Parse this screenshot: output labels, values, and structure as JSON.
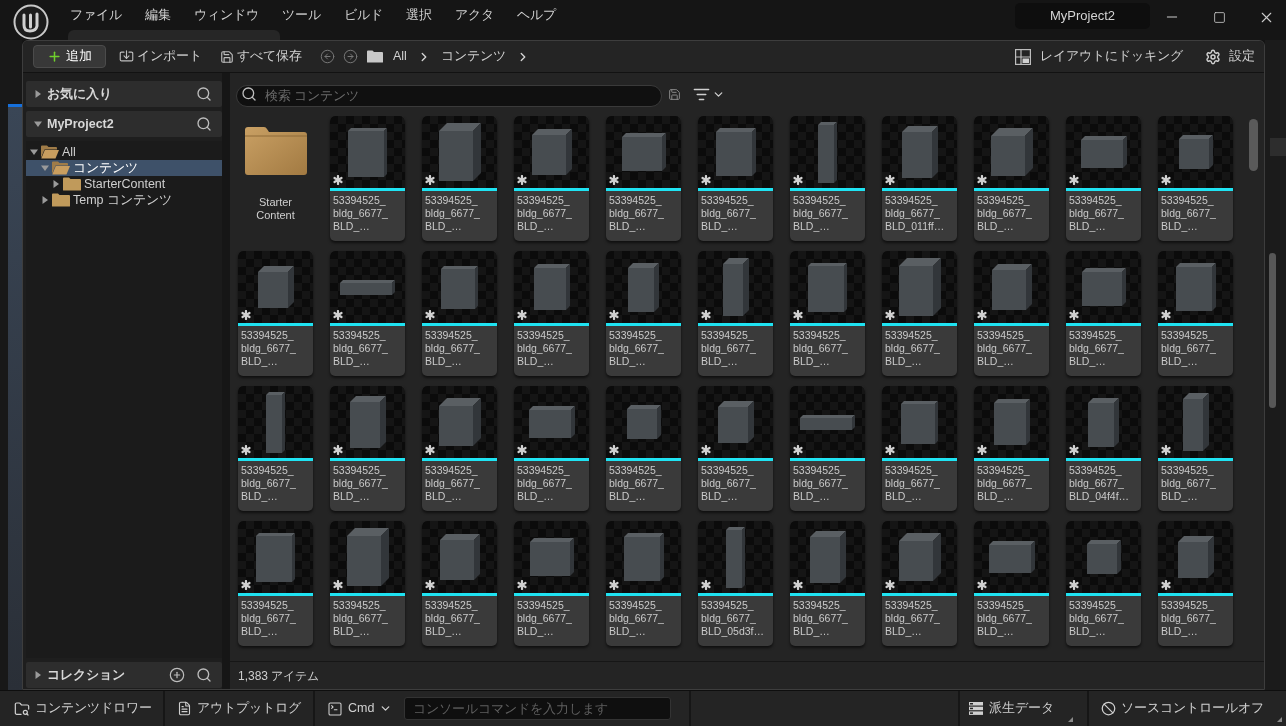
{
  "title_bar": {
    "menu": [
      "ファイル",
      "編集",
      "ウィンドウ",
      "ツール",
      "ビルド",
      "選択",
      "アクタ",
      "ヘルプ"
    ],
    "project_tab": "MyProject2"
  },
  "toolbar": {
    "add_button": "追加",
    "import_button": "インポート",
    "save_all_button": "すべて保存",
    "breadcrumb": [
      "All",
      "コンテンツ"
    ],
    "dock_button": "レイアウトにドッキング",
    "settings_button": "設定"
  },
  "sidebar": {
    "favorites": {
      "title": "お気に入り",
      "expanded": false
    },
    "project": {
      "title": "MyProject2",
      "expanded": true
    },
    "tree": [
      {
        "label": "All",
        "expanded": true,
        "selected": false,
        "children": [
          {
            "label": "コンテンツ",
            "expanded": true,
            "selected": true,
            "children": [
              {
                "label": "StarterContent",
                "expanded": false,
                "selected": false
              }
            ]
          },
          {
            "label": "Temp コンテンツ",
            "expanded": false,
            "selected": false
          }
        ]
      }
    ],
    "collections": {
      "title": "コレクション",
      "expanded": false
    }
  },
  "search": {
    "placeholder": "検索 コンテンツ"
  },
  "assets": [
    {
      "kind": "folder",
      "name": "Starter Content"
    },
    {
      "kind": "mesh",
      "name": "53394525_bldg_6677_BLD_…"
    },
    {
      "kind": "mesh",
      "name": "53394525_bldg_6677_BLD_…"
    },
    {
      "kind": "mesh",
      "name": "53394525_bldg_6677_BLD_…"
    },
    {
      "kind": "mesh",
      "name": "53394525_bldg_6677_BLD_…"
    },
    {
      "kind": "mesh",
      "name": "53394525_bldg_6677_BLD_…"
    },
    {
      "kind": "mesh",
      "name": "53394525_bldg_6677_BLD_…"
    },
    {
      "kind": "mesh",
      "name": "53394525_bldg_6677_BLD_011ff…"
    },
    {
      "kind": "mesh",
      "name": "53394525_bldg_6677_BLD_…"
    },
    {
      "kind": "mesh",
      "name": "53394525_bldg_6677_BLD_…"
    },
    {
      "kind": "mesh",
      "name": "53394525_bldg_6677_BLD_…"
    },
    {
      "kind": "mesh",
      "name": "53394525_bldg_6677_BLD_…"
    },
    {
      "kind": "mesh",
      "name": "53394525_bldg_6677_BLD_…"
    },
    {
      "kind": "mesh",
      "name": "53394525_bldg_6677_BLD_…"
    },
    {
      "kind": "mesh",
      "name": "53394525_bldg_6677_BLD_…"
    },
    {
      "kind": "mesh",
      "name": "53394525_bldg_6677_BLD_…"
    },
    {
      "kind": "mesh",
      "name": "53394525_bldg_6677_BLD_…"
    },
    {
      "kind": "mesh",
      "name": "53394525_bldg_6677_BLD_…"
    },
    {
      "kind": "mesh",
      "name": "53394525_bldg_6677_BLD_…"
    },
    {
      "kind": "mesh",
      "name": "53394525_bldg_6677_BLD_…"
    },
    {
      "kind": "mesh",
      "name": "53394525_bldg_6677_BLD_…"
    },
    {
      "kind": "mesh",
      "name": "53394525_bldg_6677_BLD_…"
    },
    {
      "kind": "mesh",
      "name": "53394525_bldg_6677_BLD_…"
    },
    {
      "kind": "mesh",
      "name": "53394525_bldg_6677_BLD_…"
    },
    {
      "kind": "mesh",
      "name": "53394525_bldg_6677_BLD_…"
    },
    {
      "kind": "mesh",
      "name": "53394525_bldg_6677_BLD_…"
    },
    {
      "kind": "mesh",
      "name": "53394525_bldg_6677_BLD_…"
    },
    {
      "kind": "mesh",
      "name": "53394525_bldg_6677_BLD_…"
    },
    {
      "kind": "mesh",
      "name": "53394525_bldg_6677_BLD_…"
    },
    {
      "kind": "mesh",
      "name": "53394525_bldg_6677_BLD_…"
    },
    {
      "kind": "mesh",
      "name": "53394525_bldg_6677_BLD_…"
    },
    {
      "kind": "mesh",
      "name": "53394525_bldg_6677_BLD_04f4f…"
    },
    {
      "kind": "mesh",
      "name": "53394525_bldg_6677_BLD_…"
    },
    {
      "kind": "mesh",
      "name": "53394525_bldg_6677_BLD_…"
    },
    {
      "kind": "mesh",
      "name": "53394525_bldg_6677_BLD_…"
    },
    {
      "kind": "mesh",
      "name": "53394525_bldg_6677_BLD_…"
    },
    {
      "kind": "mesh",
      "name": "53394525_bldg_6677_BLD_…"
    },
    {
      "kind": "mesh",
      "name": "53394525_bldg_6677_BLD_…"
    },
    {
      "kind": "mesh",
      "name": "53394525_bldg_6677_BLD_05d3f…"
    },
    {
      "kind": "mesh",
      "name": "53394525_bldg_6677_BLD_…"
    },
    {
      "kind": "mesh",
      "name": "53394525_bldg_6677_BLD_…"
    },
    {
      "kind": "mesh",
      "name": "53394525_bldg_6677_BLD_…"
    },
    {
      "kind": "mesh",
      "name": "53394525_bldg_6677_BLD_…"
    },
    {
      "kind": "mesh",
      "name": "53394525_bldg_6677_BLD_…"
    }
  ],
  "item_count": "1,383 アイテム",
  "status_bar": {
    "content_drawer_button": "コンテンツドロワー",
    "output_log_button": "アウトプットログ",
    "cmd_button": "Cmd",
    "console_input": {
      "placeholder": "コンソールコマンドを入力します"
    },
    "derived_data_button": "派生データ",
    "source_control_button": "ソースコントロールオフ"
  }
}
